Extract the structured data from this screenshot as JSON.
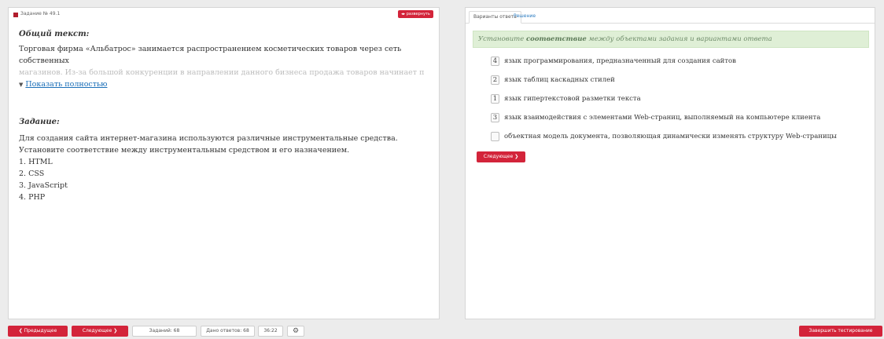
{
  "left_panel": {
    "task_number": "Задание № 49.1",
    "expand_label": "◂▸ развернуть",
    "common_title": "Общий текст:",
    "common_text_line1": "Торговая фирма «Альбатрос» занимается распространением косметических товаров через сеть собственных",
    "common_text_line2": "магазинов. Из-за большой конкуренции в направлении данного бизнеса продажа товаров начинает падать.",
    "show_full_label": "Показать полностью",
    "task_title": "Задание:",
    "task_lines": [
      "Для создания сайта интернет-магазина используются различные инструментальные средства.",
      "Установите соответствие между инструментальным средством и его назначением.",
      "1. HTML",
      "2. CSS",
      "3. JavaScript",
      "4. PHP"
    ]
  },
  "right_panel": {
    "tabs": [
      "Варианты ответа",
      "Решение"
    ],
    "instruction_prefix": "Установите",
    "instruction_bold": "соответствие",
    "instruction_suffix": "между объектами задания и вариантами ответа",
    "options": [
      {
        "value": "4",
        "text": "язык программирования, предназначенный для создания сайтов"
      },
      {
        "value": "2",
        "text": "язык таблиц каскадных стилей"
      },
      {
        "value": "1",
        "text": "язык гипертекстовой разметки текста"
      },
      {
        "value": "3",
        "text": "язык взаимодействия с элементами Web-страниц, выполняемый на компьютере клиента"
      },
      {
        "value": "",
        "text": "объектная модель документа, позволяющая динамически изменять структуру Web-страницы"
      }
    ],
    "next_label": "Следующее ❯"
  },
  "bottom_bar": {
    "prev_label": "❮ Предыдущее",
    "next_label": "Следующее ❯",
    "tasks_label": "Заданий: 68",
    "answers_label": "Дано ответов: 68",
    "timer": "36:22",
    "settings_icon": "⚙",
    "finish_label": "Завершить тестирование"
  },
  "colors": {
    "accent": "#d3243a",
    "instruction_bg": "#dfefd6",
    "link": "#1b6fb8"
  }
}
